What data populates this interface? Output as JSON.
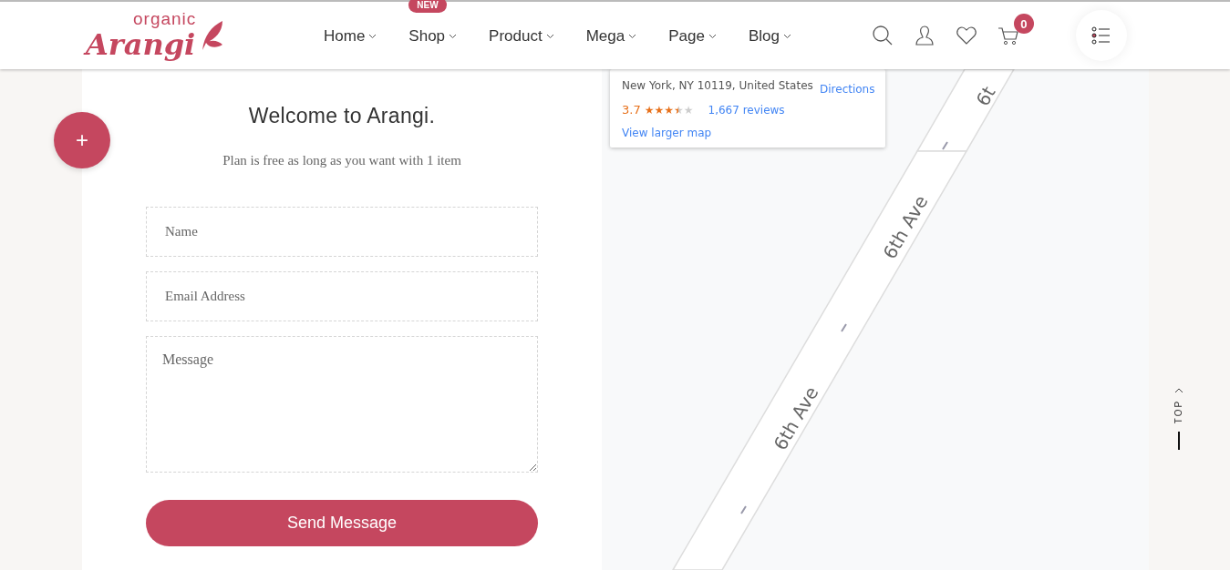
{
  "header": {
    "logo": {
      "small": "organic",
      "large": "Arangi"
    },
    "nav": [
      {
        "label": "Home"
      },
      {
        "label": "Shop",
        "badge": "NEW"
      },
      {
        "label": "Product"
      },
      {
        "label": "Mega"
      },
      {
        "label": "Page"
      },
      {
        "label": "Blog"
      }
    ],
    "cart_count": "0"
  },
  "fab": {
    "label": "+"
  },
  "form": {
    "title": "Welcome to Arangi.",
    "subtitle": "Plan is free as long as you want with 1 item",
    "fields": [
      {
        "kind": "input",
        "placeholder": "Name"
      },
      {
        "kind": "input",
        "placeholder": "Email Address"
      },
      {
        "kind": "textarea",
        "placeholder": "Message"
      }
    ],
    "submit": "Send Message"
  },
  "map": {
    "address": "New York, NY 10119, United States",
    "directions": "Directions",
    "rating": "3.7",
    "stars": 3.5,
    "reviews": "1,667 reviews",
    "larger_map": "View larger map",
    "street_labels": [
      "6t",
      "6th Ave",
      "6th Ave"
    ]
  },
  "back_to_top": "TOP"
}
